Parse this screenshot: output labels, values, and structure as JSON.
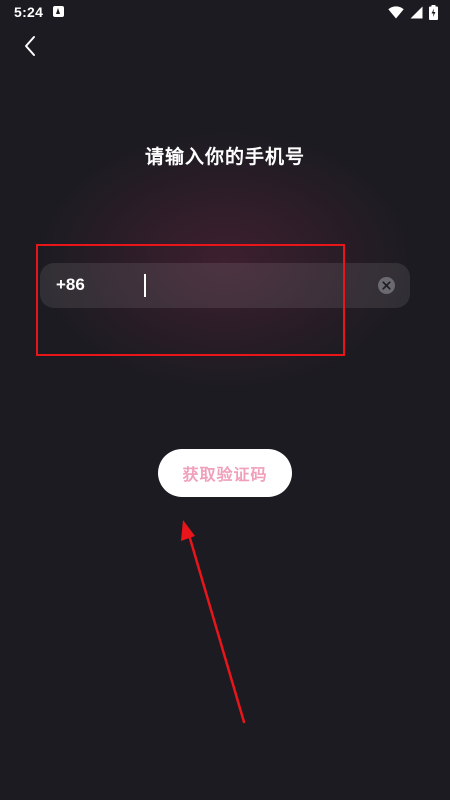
{
  "status_bar": {
    "time": "5:24"
  },
  "header": {
    "title": "请输入你的手机号"
  },
  "phone_input": {
    "country_code": "+86",
    "value": "",
    "placeholder": ""
  },
  "actions": {
    "get_code_label": "获取验证码"
  },
  "icons": {
    "back": "chevron-left-icon",
    "clear": "clear-circle-icon",
    "wifi": "wifi-icon",
    "signal": "cell-signal-icon",
    "battery": "battery-charging-icon",
    "notification": "notification-app-icon"
  },
  "colors": {
    "background": "#1b1b21",
    "annotation": "#e8151b",
    "button_text": "#f0a0b8",
    "button_background": "#ffffff"
  }
}
